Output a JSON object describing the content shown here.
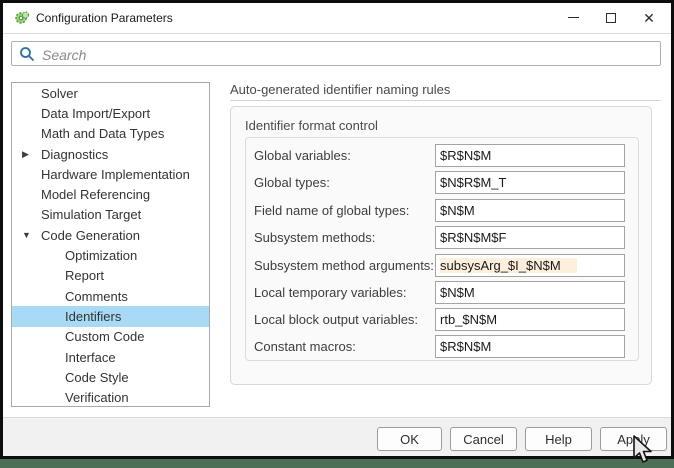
{
  "window": {
    "title": "Configuration Parameters"
  },
  "search": {
    "placeholder": "Search"
  },
  "sidebar": {
    "items": [
      {
        "label": "Solver",
        "level": 1,
        "selected": false
      },
      {
        "label": "Data Import/Export",
        "level": 1,
        "selected": false
      },
      {
        "label": "Math and Data Types",
        "level": 1,
        "selected": false
      },
      {
        "label": "Diagnostics",
        "level": 1,
        "selected": false,
        "arrow": "▶",
        "state": "collapsed"
      },
      {
        "label": "Hardware Implementation",
        "level": 1,
        "selected": false
      },
      {
        "label": "Model Referencing",
        "level": 1,
        "selected": false
      },
      {
        "label": "Simulation Target",
        "level": 1,
        "selected": false
      },
      {
        "label": "Code Generation",
        "level": 1,
        "selected": false,
        "arrow": "▼",
        "state": "expanded"
      },
      {
        "label": "Optimization",
        "level": 2,
        "selected": false
      },
      {
        "label": "Report",
        "level": 2,
        "selected": false
      },
      {
        "label": "Comments",
        "level": 2,
        "selected": false
      },
      {
        "label": "Identifiers",
        "level": 2,
        "selected": true
      },
      {
        "label": "Custom Code",
        "level": 2,
        "selected": false
      },
      {
        "label": "Interface",
        "level": 2,
        "selected": false
      },
      {
        "label": "Code Style",
        "level": 2,
        "selected": false
      },
      {
        "label": "Verification",
        "level": 2,
        "selected": false
      }
    ]
  },
  "main": {
    "heading": "Auto-generated identifier naming rules",
    "group": {
      "title": "Identifier format control",
      "fields": [
        {
          "label": "Global variables:",
          "value": "$R$N$M",
          "modified": false
        },
        {
          "label": "Global types:",
          "value": "$N$R$M_T",
          "modified": false
        },
        {
          "label": "Field name of global types:",
          "value": "$N$M",
          "modified": false
        },
        {
          "label": "Subsystem methods:",
          "value": "$R$N$M$F",
          "modified": false
        },
        {
          "label": "Subsystem method arguments:",
          "value": "subsysArg_$I_$N$M",
          "modified": true
        },
        {
          "label": "Local temporary variables:",
          "value": "$N$M",
          "modified": false
        },
        {
          "label": "Local block output variables:",
          "value": "rtb_$N$M",
          "modified": false
        },
        {
          "label": "Constant macros:",
          "value": "$R$N$M",
          "modified": false
        }
      ]
    }
  },
  "footer": {
    "buttons": [
      "OK",
      "Cancel",
      "Help",
      "Apply"
    ]
  },
  "icons": {
    "app": "green-gear",
    "search": "magnifier",
    "minimize": "minus",
    "maximize": "square",
    "close": "✕",
    "tree_collapsed": "▶",
    "tree_expanded": "▼",
    "cursor": "arrow-pointer"
  },
  "colors": {
    "selection_highlight": "#a8d9f5",
    "modified_field_bg": "#fcefdc",
    "desktop_background": "#4d6e57",
    "search_icon_blue": "#2e6da6",
    "app_icon_green": "#5aa845",
    "window_border": "#0d0d0d"
  }
}
